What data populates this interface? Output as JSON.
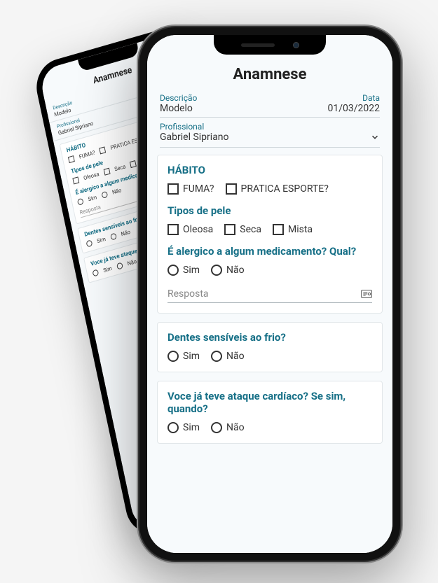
{
  "title": "Anamnese",
  "meta": {
    "descricao_label": "Descrição",
    "descricao_value": "Modelo",
    "data_label": "Data",
    "data_value": "01/03/2022",
    "profissional_label": "Profissional",
    "profissional_value": "Gabriel Sipriano"
  },
  "sections": {
    "habito": {
      "label": "HÁBITO",
      "option_fuma": "FUMA?",
      "option_esporte": "PRATICA ESPORTE?"
    },
    "pele": {
      "label": "Tipos de pele",
      "option_oleosa": "Oleosa",
      "option_seca": "Seca",
      "option_mista": "Mista"
    },
    "alergia": {
      "label": "É alergico a algum medicamento? Qual?",
      "option_sim": "Sim",
      "option_nao": "Não",
      "resposta_placeholder": "Resposta"
    },
    "dentes": {
      "label": "Dentes sensíveis ao frio?",
      "option_sim": "Sim",
      "option_nao": "Não"
    },
    "cardiaco": {
      "label": "Voce já teve ataque cardíaco? Se sim, quando?",
      "option_sim": "Sim",
      "option_nao": "Não"
    }
  }
}
